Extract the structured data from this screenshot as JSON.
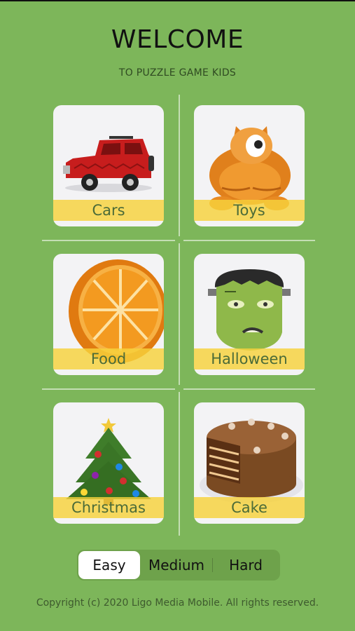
{
  "header": {
    "title": "WELCOME",
    "subtitle": "TO PUZZLE GAME KIDS"
  },
  "categories": [
    {
      "label": "Cars",
      "icon": "car-icon"
    },
    {
      "label": "Toys",
      "icon": "cat-toy-icon"
    },
    {
      "label": "Food",
      "icon": "orange-icon"
    },
    {
      "label": "Halloween",
      "icon": "frankenstein-icon"
    },
    {
      "label": "Christmas",
      "icon": "christmas-tree-icon"
    },
    {
      "label": "Cake",
      "icon": "cake-icon"
    }
  ],
  "difficulty": {
    "options": [
      "Easy",
      "Medium",
      "Hard"
    ],
    "selected": "Easy"
  },
  "footer": {
    "copyright": "Copyright (c) 2020 Ligo Media Mobile. All rights reserved."
  },
  "colors": {
    "background": "#7db65a",
    "label_band": "#f7d23c",
    "label_text": "#4b6b38",
    "card": "#f3f3f5"
  }
}
